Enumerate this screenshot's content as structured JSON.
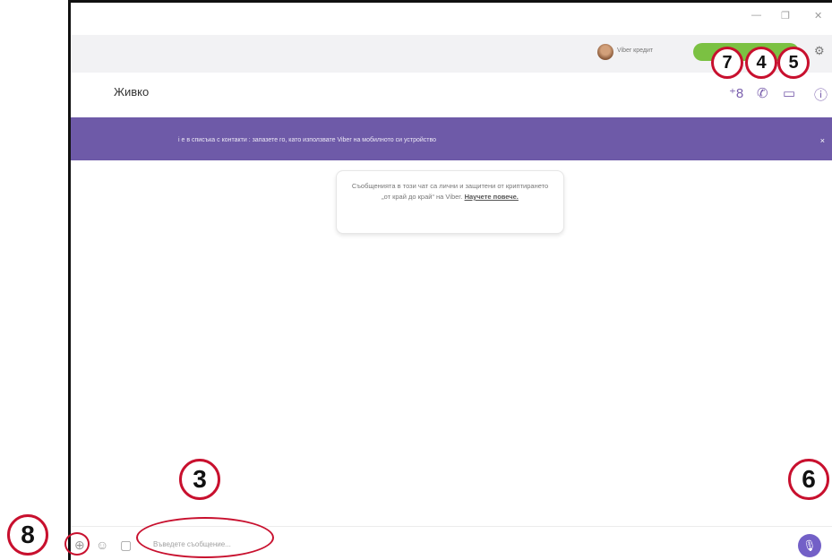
{
  "titlebar": {
    "minimize_glyph": "—",
    "restore_glyph": "❐",
    "close_glyph": "✕"
  },
  "topbar": {
    "credits_text": "Viber кредит",
    "settings_icon": "gear-icon"
  },
  "chat": {
    "contact_name": "Живко",
    "header_icons": [
      "add-participant-icon",
      "call-icon",
      "video-call-icon",
      "info-icon"
    ]
  },
  "banner": {
    "text": "і е в списъка с контакти : запазете го, като използвате Viber на мобилното си устройство",
    "close": "×"
  },
  "notice": {
    "text": "Съобщенията в този чат са лични и защитени от криптирането „от край до край“ на Viber.",
    "link": "Научете повече."
  },
  "input": {
    "placeholder": "Въведете съобщение...",
    "icons": [
      "plus-icon",
      "sticker-icon",
      "gif-icon",
      "microphone-icon"
    ]
  },
  "annotations": {
    "n3": "3",
    "n4": "4",
    "n5": "5",
    "n6": "6",
    "n7": "7",
    "n8": "8"
  },
  "colors": {
    "accent": "#6e5aa8",
    "green": "#7bc142",
    "annotation": "#c8102e"
  }
}
